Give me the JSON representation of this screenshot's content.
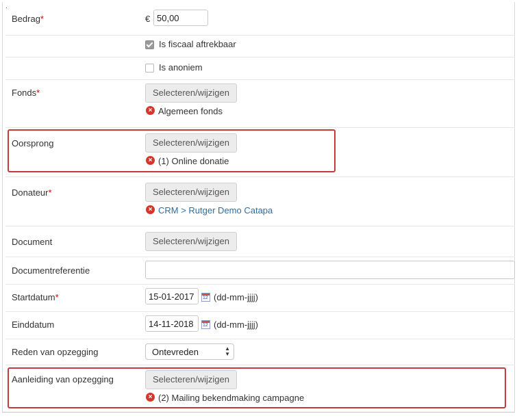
{
  "page": {
    "marker": "."
  },
  "fields": {
    "bedrag": {
      "label": "Bedrag",
      "required": "*",
      "currency": "€",
      "value": "50,00"
    },
    "fiscaal": {
      "label": "Is fiscaal aftrekbaar",
      "checked": true
    },
    "anoniem": {
      "label": "Is anoniem",
      "checked": false
    },
    "fonds": {
      "label": "Fonds",
      "required": "*",
      "button": "Selecteren/wijzigen",
      "selection": "Algemeen fonds"
    },
    "oorsprong": {
      "label": "Oorsprong",
      "button": "Selecteren/wijzigen",
      "selection": "(1) Online donatie"
    },
    "donateur": {
      "label": "Donateur",
      "required": "*",
      "button": "Selecteren/wijzigen",
      "selection": "CRM > Rutger Demo Catapa"
    },
    "document": {
      "label": "Document",
      "button": "Selecteren/wijzigen"
    },
    "documentreferentie": {
      "label": "Documentreferentie",
      "value": ""
    },
    "startdatum": {
      "label": "Startdatum",
      "required": "*",
      "value": "15-01-2017",
      "format": "(dd-mm-jjjj)",
      "cal_day": "12"
    },
    "einddatum": {
      "label": "Einddatum",
      "value": "14-11-2018",
      "format": "(dd-mm-jjjj)",
      "cal_day": "12"
    },
    "reden": {
      "label": "Reden van opzegging",
      "selected": "Ontevreden"
    },
    "aanleiding": {
      "label": "Aanleiding van opzegging",
      "button": "Selecteren/wijzigen",
      "selection": "(2) Mailing bekendmaking campagne"
    }
  },
  "icons": {
    "remove": "×",
    "select_arrows": "▲▼"
  },
  "colors": {
    "required": "#d40000",
    "error_icon": "#d9362b",
    "highlight": "#c43a3a",
    "link": "#2a6ea6"
  }
}
